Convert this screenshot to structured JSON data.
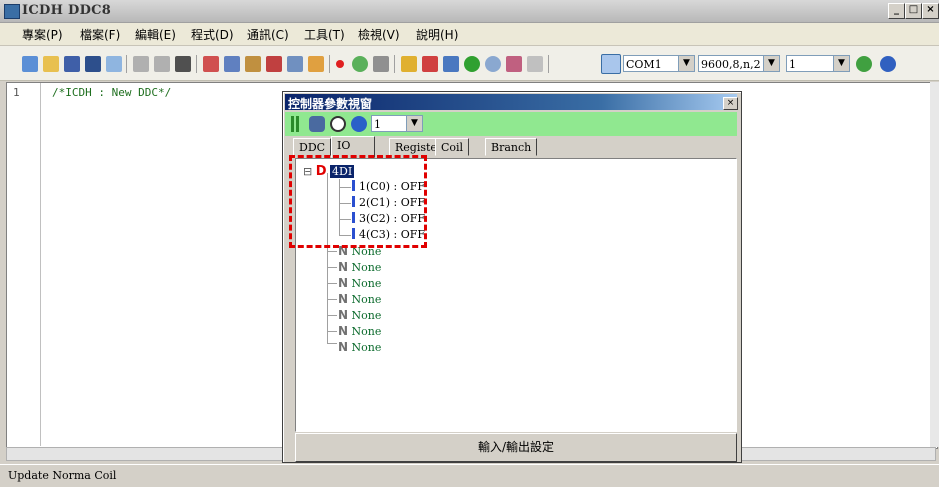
{
  "window": {
    "title": "ICDH DDC8",
    "min": "_",
    "max": "□",
    "close": "×"
  },
  "menu": [
    "專案(P)",
    "檔案(F)",
    "編輯(E)",
    "程式(D)",
    "通訊(C)",
    "工具(T)",
    "檢視(V)",
    "說明(H)"
  ],
  "toolbar": {
    "port": "COM1",
    "serial_settings": "9600,8,n,2",
    "station": "1",
    "icons": [
      "new-file-icon",
      "open-icon",
      "save-icon",
      "save-as-icon",
      "window-icon",
      "undo-icon",
      "redo-icon",
      "find-icon",
      "cut-icon",
      "copy-icon",
      "paste-icon",
      "delete-icon",
      "compile-icon",
      "debug-icon",
      "dot-icon",
      "color-icon",
      "pen-icon",
      "key-icon",
      "upload-icon",
      "download-icon",
      "run-icon",
      "search-icon",
      "erase-icon",
      "config-icon"
    ]
  },
  "editor": {
    "line_number": "1",
    "code": "/*ICDH : New DDC*/"
  },
  "status": "Update Norma Coil",
  "dialog": {
    "title": "控制器參數視窗",
    "close": "×",
    "station_value": "1",
    "tabs": [
      "DDC",
      "IO",
      "Register",
      "Coil",
      "Branch"
    ],
    "active_tab": "IO",
    "tree": {
      "expand_symbol": "⊟",
      "root_letter": "D",
      "root_label": "4DI",
      "children": [
        "1(C0) : OFF",
        "2(C1) : OFF",
        "3(C2) : OFF",
        "4(C3) : OFF"
      ],
      "none_letter": "N",
      "none_items": [
        "None",
        "None",
        "None",
        "None",
        "None",
        "None",
        "None"
      ]
    },
    "io_button": "輸入/輸出設定"
  },
  "colors": {
    "highlight": "#e00000",
    "tool_strip": "#90e890",
    "code_green": "#1f6f1f",
    "none_green": "#0b6a2c"
  }
}
